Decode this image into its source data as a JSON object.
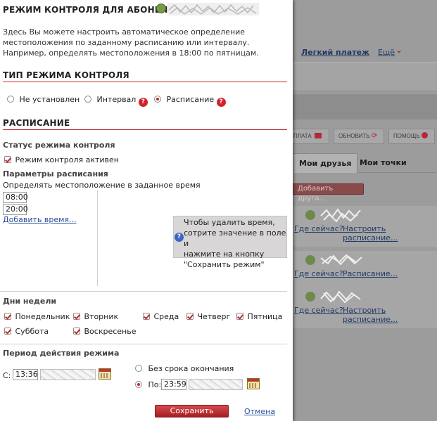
{
  "modal": {
    "title": "РЕЖИМ КОНТРОЛЯ ДЛЯ АБОНЕНТА",
    "intro": "Здесь Вы можете настроить автоматическое определение местоположения по заданному расписанию или интервалу. Например, определять местоположения в 18:00 по пятницам.",
    "control_type": {
      "heading": "ТИП РЕЖИМА КОНТРОЛЯ",
      "options": [
        {
          "label": "Не установлен",
          "selected": false
        },
        {
          "label": "Интервал",
          "selected": false,
          "help": "?"
        },
        {
          "label": "Расписание",
          "selected": true,
          "help": "?"
        }
      ]
    },
    "schedule": {
      "heading": "РАСПИСАНИЕ",
      "status_label": "Статус режима контроля",
      "active_label": "Режим контроля активен",
      "active_checked": true,
      "params_label": "Параметры расписания",
      "params_hint": "Определять местоположение в заданное время",
      "times": [
        "08:00",
        "20:00"
      ],
      "add_time_link": "Добавить время...",
      "tooltip_icon": "?",
      "tooltip": "Чтобы удалить время,\nсотрите значение в поле и\nнажмите на кнопку\n\"Сохранить режим\""
    },
    "weekdays": {
      "heading": "Дни недели",
      "days": [
        {
          "label": "Понедельник",
          "checked": true
        },
        {
          "label": "Вторник",
          "checked": true
        },
        {
          "label": "Среда",
          "checked": true
        },
        {
          "label": "Четверг",
          "checked": true
        },
        {
          "label": "Пятница",
          "checked": true
        },
        {
          "label": "Суббота",
          "checked": true
        },
        {
          "label": "Воскресенье",
          "checked": true
        }
      ]
    },
    "period": {
      "heading": "Период действия режима",
      "from_label": "С:",
      "from_time": "13:36",
      "no_end_label": "Без срока окончания",
      "no_end_selected": false,
      "to_label": "По:",
      "to_time": "23:59",
      "to_selected": true
    },
    "save_button": "Сохранить режим",
    "cancel_link": "Отмена"
  },
  "background": {
    "easy_pay_link": "Легкий платеж",
    "more_link": "Ещё",
    "more_chevron": "⌄",
    "toolbar": [
      "ПЛАТА",
      "ОБНОВИТЬ",
      "ПОМОЩЬ"
    ],
    "tabs": [
      {
        "label": "Мои друзья",
        "active": true
      },
      {
        "label": "Мои точки",
        "active": false
      }
    ],
    "add_friend_button": "Добавить друга...",
    "friends": [
      {
        "where": "Где сейчас?",
        "schedule": "Настроить расписание..."
      },
      {
        "where": "Где сейчас?",
        "schedule": "Расписание..."
      },
      {
        "where": "Где сейчас?",
        "schedule": "Настроить расписание..."
      }
    ]
  },
  "colors": {
    "accent_red": "#c2262b",
    "link_blue": "#2a4f9c",
    "overlay_gray": "#9c9c9c"
  }
}
